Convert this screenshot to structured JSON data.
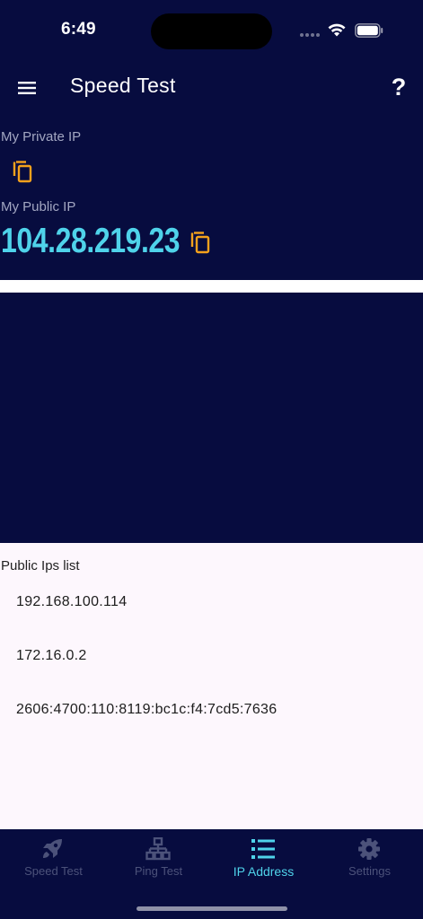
{
  "status_bar": {
    "time": "6:49"
  },
  "app_bar": {
    "title": "Speed Test",
    "help": "?"
  },
  "private_ip": {
    "label": "My Private IP"
  },
  "public_ip": {
    "label": "My Public IP",
    "value": "104.28.219.23"
  },
  "public_ips_list": {
    "title": "Public Ips list",
    "items": [
      "192.168.100.114",
      "172.16.0.2",
      "2606:4700:110:8119:bc1c:f4:7cd5:7636"
    ]
  },
  "bottom_nav": {
    "items": [
      {
        "label": "Speed Test",
        "icon": "rocket-icon"
      },
      {
        "label": "Ping Test",
        "icon": "network-icon"
      },
      {
        "label": "IP Address",
        "icon": "list-icon"
      },
      {
        "label": "Settings",
        "icon": "gear-icon"
      }
    ],
    "active_index": 2
  },
  "colors": {
    "background": "#070c3f",
    "accent": "#4fd3ea",
    "copy_icon": "#f4a11c",
    "nav_inactive": "#4c527a",
    "list_background": "#fdf7fd"
  }
}
